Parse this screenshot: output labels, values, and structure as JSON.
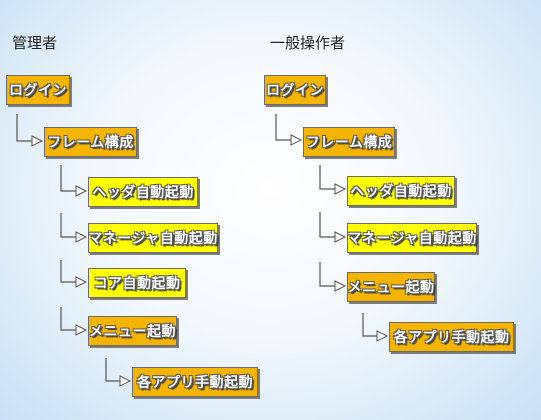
{
  "admin": {
    "heading": "管理者",
    "nodes": [
      {
        "label": "ログイン",
        "color": "#f5b400"
      },
      {
        "label": "フレーム構成",
        "color": "#f5b400"
      },
      {
        "label": "ヘッダ自動起動",
        "color": "#ffff00"
      },
      {
        "label": "マネージャ自動起動",
        "color": "#ffff00"
      },
      {
        "label": "コア自動起動",
        "color": "#ffff00"
      },
      {
        "label": "メニュー起動",
        "color": "#f5b400"
      },
      {
        "label": "各アプリ手動起動",
        "color": "#f5b400"
      }
    ]
  },
  "operator": {
    "heading": "一般操作者",
    "nodes": [
      {
        "label": "ログイン",
        "color": "#f5b400"
      },
      {
        "label": "フレーム構成",
        "color": "#f5b400"
      },
      {
        "label": "ヘッダ自動起動",
        "color": "#ffff00"
      },
      {
        "label": "マネージャ自動起動",
        "color": "#ffff00"
      },
      {
        "label": "メニュー起動",
        "color": "#f5b400"
      },
      {
        "label": "各アプリ手動起動",
        "color": "#f5b400"
      }
    ]
  }
}
